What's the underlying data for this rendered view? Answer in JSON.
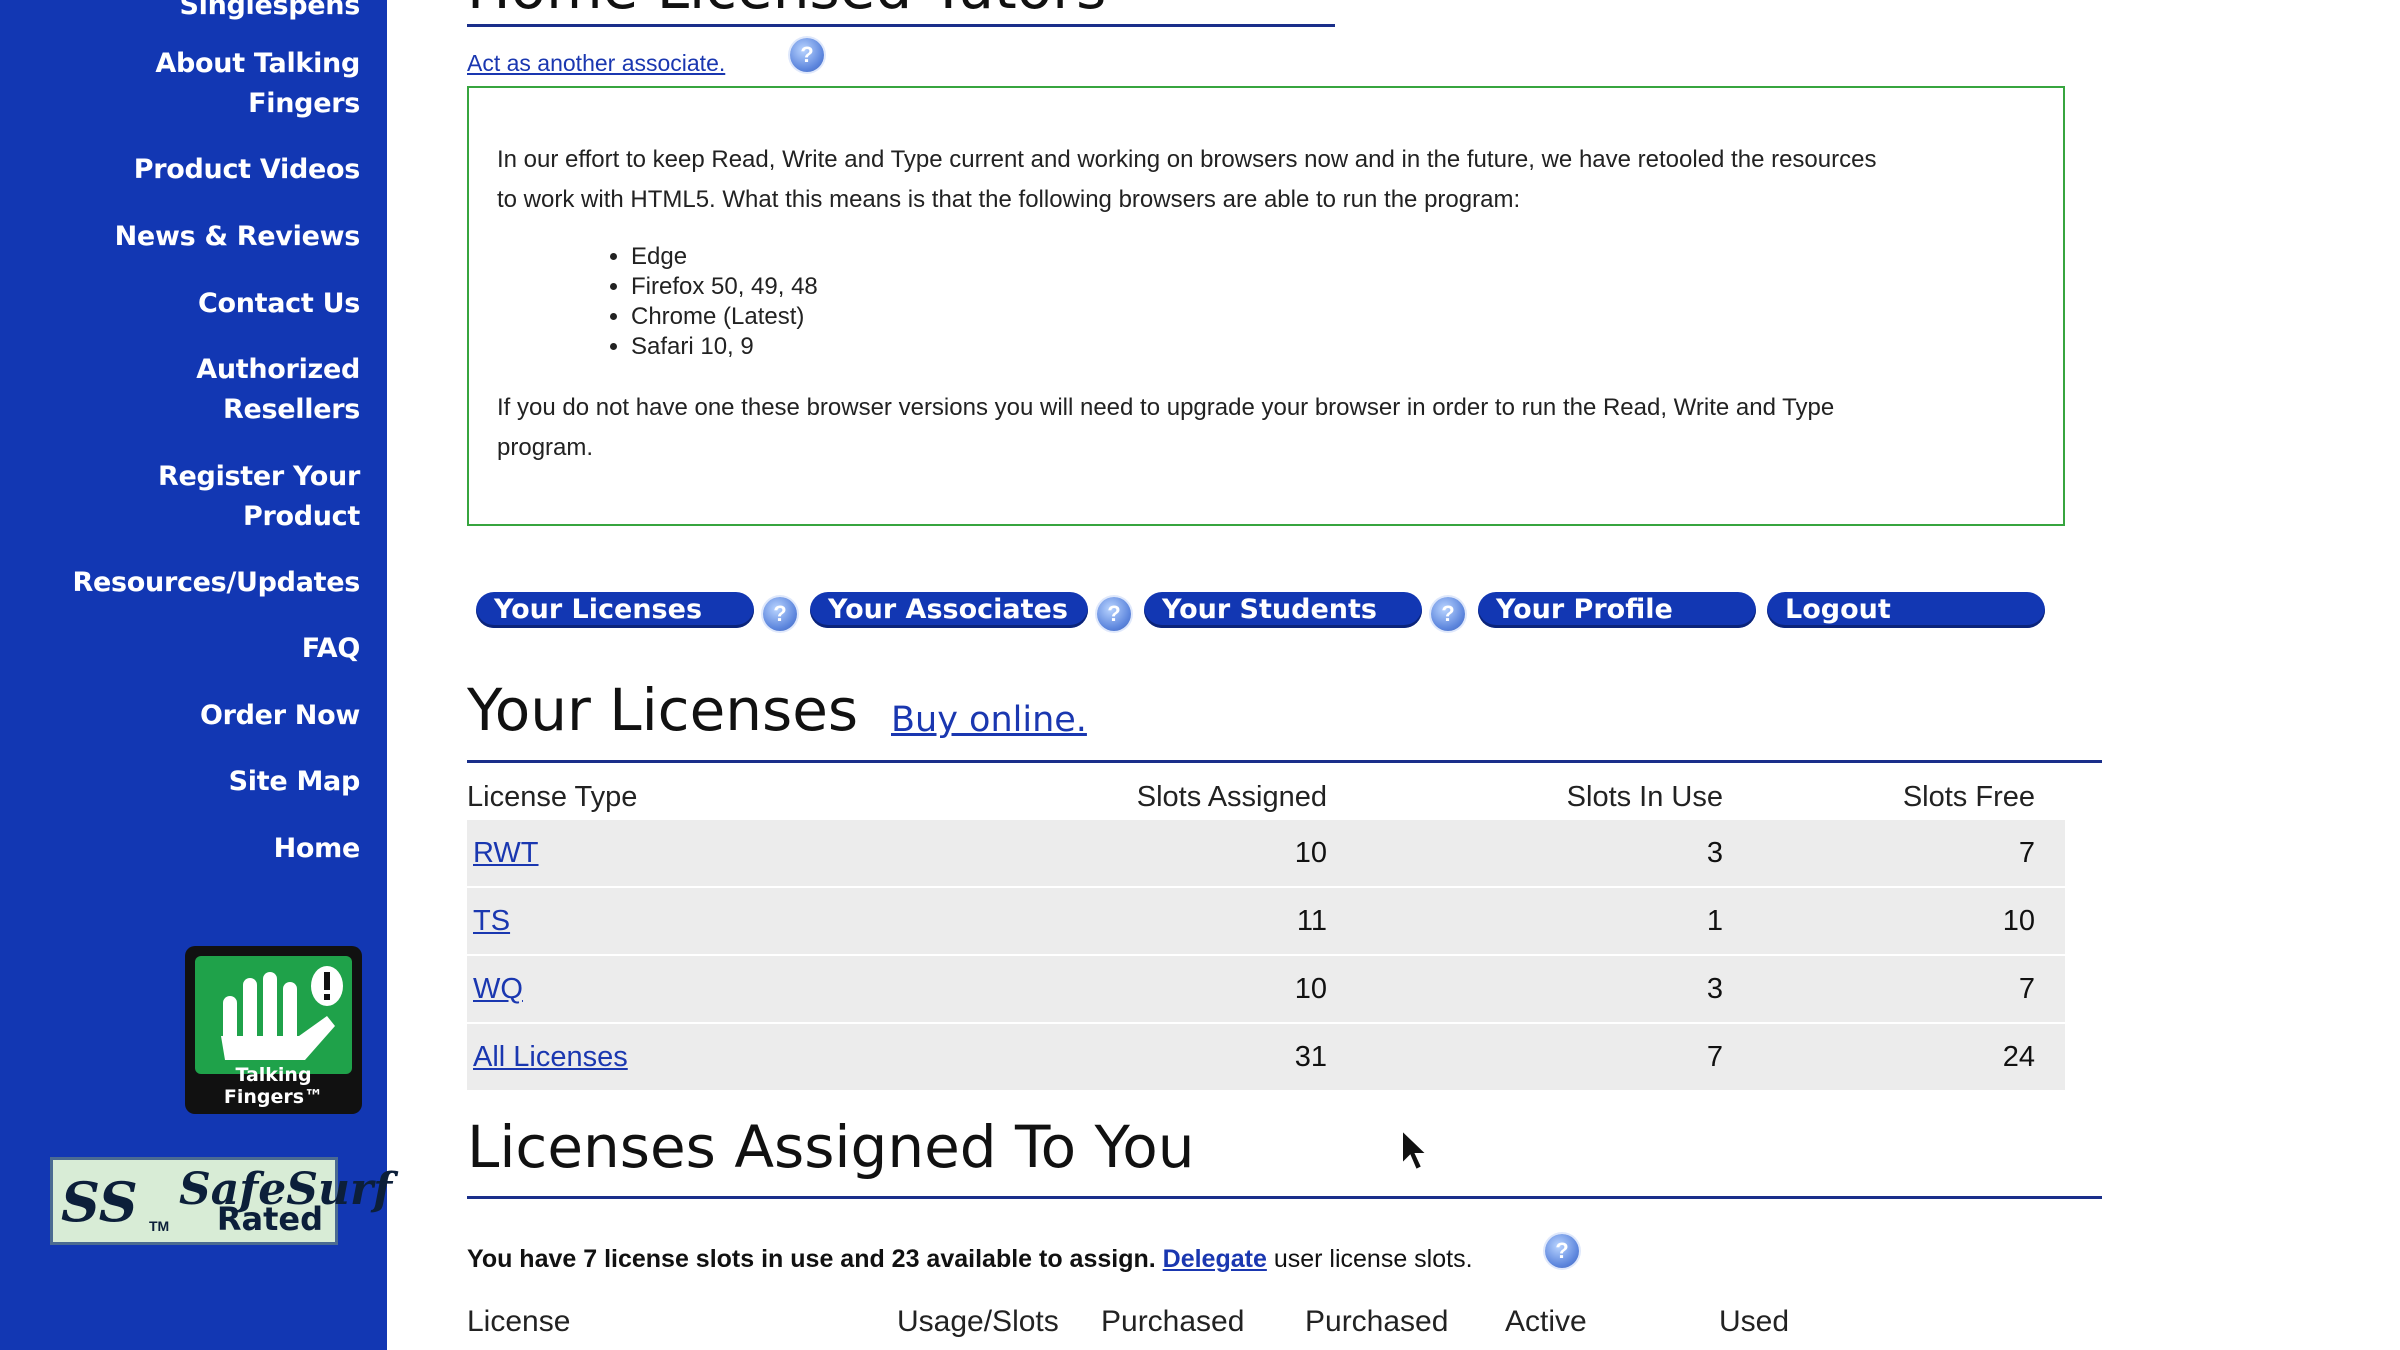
{
  "sidebar": {
    "top_cut_item": "Singlespens",
    "items": [
      {
        "label_line1": "About Talking",
        "label_line2": "Fingers"
      },
      {
        "label_line1": "Product Videos"
      },
      {
        "label_line1": "News & Reviews"
      },
      {
        "label_line1": "Contact Us"
      },
      {
        "label_line1": "Authorized",
        "label_line2": "Resellers"
      },
      {
        "label_line1": "Register Your",
        "label_line2": "Product"
      },
      {
        "label_line1": "Resources/Updates"
      },
      {
        "label_line1": "FAQ"
      },
      {
        "label_line1": "Order Now"
      },
      {
        "label_line1": "Site Map"
      },
      {
        "label_line1": "Home"
      }
    ],
    "logo_text": "Talking Fingers™",
    "safesurf": {
      "name": "SafeSurf",
      "rated": "Rated",
      "tm": "TM"
    }
  },
  "header": {
    "page_title_cut": "Home Licensed Tutors",
    "act_as_link": "Act as another associate."
  },
  "notice": {
    "intro_line1": "In our effort to keep Read, Write and Type current and working on browsers now and in the future, we have retooled the resources",
    "intro_line2": "to work with HTML5. What this means is that the following browsers are able to run the program:",
    "browsers": [
      "Edge",
      "Firefox 50, 49, 48",
      "Chrome (Latest)",
      "Safari 10, 9"
    ],
    "outro_line1": "If you do not have one these browser versions you will need to upgrade your browser in order to run the Read, Write and Type",
    "outro_line2": "program."
  },
  "tabs": [
    "Your Licenses",
    "Your Associates",
    "Your Students",
    "Your Profile",
    "Logout"
  ],
  "licenses": {
    "heading": "Your Licenses",
    "buy_link": "Buy online.",
    "columns": [
      "License Type",
      "Slots Assigned",
      "Slots In Use",
      "Slots Free"
    ],
    "rows": [
      {
        "type": "RWT",
        "assigned": "10",
        "in_use": "3",
        "free": "7"
      },
      {
        "type": "TS",
        "assigned": "11",
        "in_use": "1",
        "free": "10"
      },
      {
        "type": "WQ",
        "assigned": "10",
        "in_use": "3",
        "free": "7"
      },
      {
        "type": "All Licenses",
        "assigned": "31",
        "in_use": "7",
        "free": "24"
      }
    ]
  },
  "assigned": {
    "heading": "Licenses Assigned To You",
    "text_bold": "You have 7 license slots in use and 23 available to assign.",
    "delegate_link": "Delegate",
    "text_after": "user license slots.",
    "columns": [
      "License",
      "Usage/Slots",
      "Purchased",
      "Purchased",
      "Active",
      "Used"
    ]
  },
  "help_glyph": "?",
  "colors": {
    "sidebar": "#1237b3",
    "notice_border": "#37a53f",
    "link": "#1a37b0",
    "rule": "#1a2f8a"
  }
}
